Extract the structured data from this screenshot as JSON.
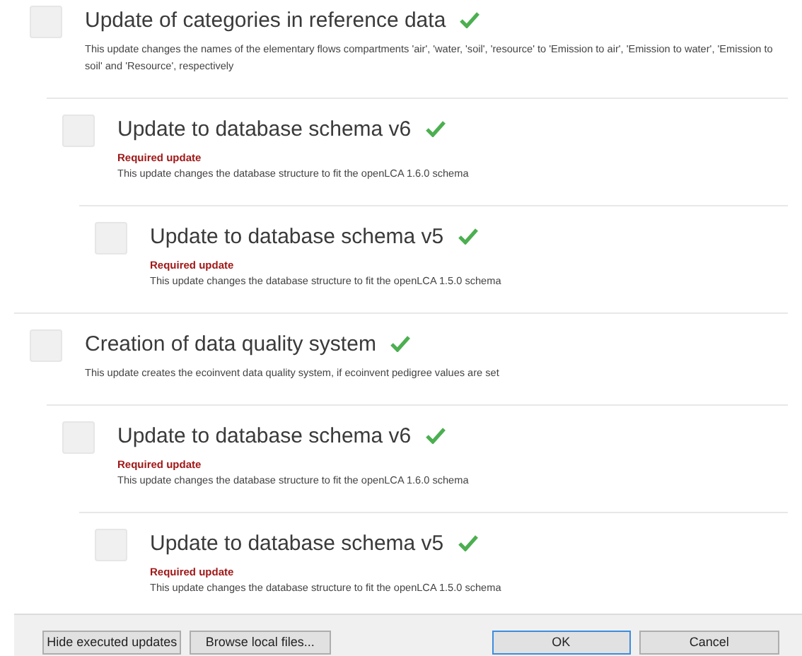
{
  "updates": [
    {
      "title": "Update of categories in reference data",
      "checked": false,
      "executed": true,
      "required": false,
      "description": "This update changes the names of the elementary flows compartments 'air', 'water, 'soil', 'resource' to 'Emission to air', 'Emission to water', 'Emission to soil' and 'Resource', respectively",
      "children": [
        {
          "title": "Update to database schema v6",
          "checked": false,
          "executed": true,
          "required": true,
          "required_label": "Required update",
          "description": "This update changes the database structure to fit the openLCA 1.6.0 schema",
          "children": [
            {
              "title": "Update to database schema v5",
              "checked": false,
              "executed": true,
              "required": true,
              "required_label": "Required update",
              "description": "This update changes the database structure to fit the openLCA 1.5.0 schema"
            }
          ]
        }
      ]
    },
    {
      "title": "Creation of data quality system",
      "checked": false,
      "executed": true,
      "required": false,
      "description": "This update creates the ecoinvent data quality system, if ecoinvent pedigree values are set",
      "children": [
        {
          "title": "Update to database schema v6",
          "checked": false,
          "executed": true,
          "required": true,
          "required_label": "Required update",
          "description": "This update changes the database structure to fit the openLCA 1.6.0 schema",
          "children": [
            {
              "title": "Update to database schema v5",
              "checked": false,
              "executed": true,
              "required": true,
              "required_label": "Required update",
              "description": "This update changes the database structure to fit the openLCA 1.5.0 schema"
            }
          ]
        }
      ]
    }
  ],
  "buttons": [
    {
      "label": "Hide executed updates",
      "default": false
    },
    {
      "label": "Browse local files...",
      "default": false
    },
    {
      "label": "OK",
      "default": true
    },
    {
      "label": "Cancel",
      "default": false
    }
  ]
}
